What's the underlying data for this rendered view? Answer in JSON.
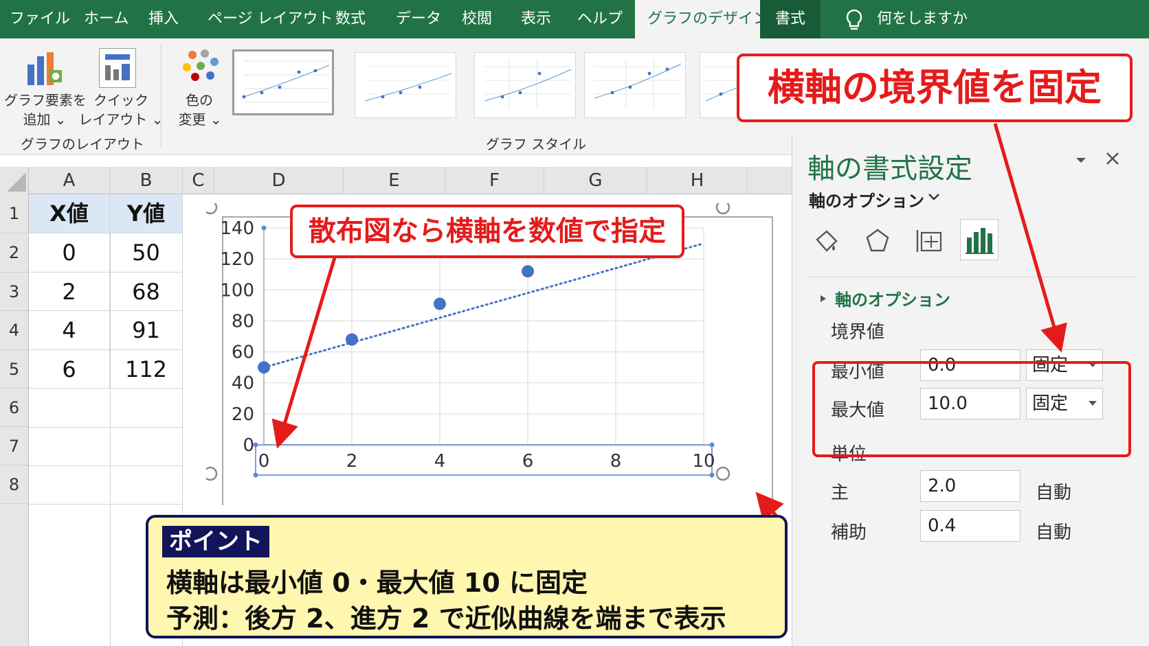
{
  "tabs": [
    "ファイル",
    "ホーム",
    "挿入",
    "ページ レイアウト",
    "数式",
    "データ",
    "校閲",
    "表示",
    "ヘルプ",
    "グラフのデザイン",
    "書式"
  ],
  "tell_me": "何をしますか",
  "ribbon": {
    "add_element_line1": "グラフ要素を",
    "add_element_line2": "追加 ⌄",
    "quick_layout_line1": "クイック",
    "quick_layout_line2": "レイアウト ⌄",
    "change_color_line1": "色の",
    "change_color_line2": "変更 ⌄",
    "group_layout": "グラフのレイアウト",
    "group_style": "グラフ スタイル"
  },
  "sheet": {
    "columns": [
      "A",
      "B",
      "C",
      "D",
      "E",
      "F",
      "G",
      "H"
    ],
    "rows": [
      "1",
      "2",
      "3",
      "4",
      "5",
      "6",
      "7",
      "8"
    ],
    "header_x": "X値",
    "header_y": "Y値",
    "x_values": [
      "0",
      "2",
      "4",
      "6"
    ],
    "y_values": [
      "50",
      "68",
      "91",
      "112"
    ]
  },
  "chart_data": {
    "type": "scatter",
    "x": [
      0,
      2,
      4,
      6
    ],
    "y": [
      50,
      68,
      91,
      112
    ],
    "xlim": [
      0,
      10
    ],
    "ylim": [
      0,
      140
    ],
    "x_ticks": [
      "0",
      "2",
      "4",
      "6",
      "8",
      "10"
    ],
    "y_ticks": [
      "0",
      "20",
      "40",
      "60",
      "80",
      "100",
      "120",
      "140"
    ],
    "trendline": {
      "style": "dotted",
      "from": [
        0,
        50
      ],
      "to": [
        10,
        130
      ]
    },
    "grid": true,
    "point_color": "#4472c4"
  },
  "pane": {
    "title": "軸の書式設定",
    "options_dropdown": "軸のオプション",
    "section": "軸のオプション",
    "bounds_label": "境界値",
    "min_label": "最小値",
    "min_value": "0.0",
    "min_mode": "固定",
    "max_label": "最大値",
    "max_value": "10.0",
    "max_mode": "固定",
    "units_label": "単位",
    "major_label": "主",
    "major_value": "2.0",
    "major_mode": "自動",
    "minor_label": "補助",
    "minor_value": "0.4",
    "minor_mode": "自動"
  },
  "annotations": {
    "top_callout": "横軸の境界値を固定",
    "chart_callout": "散布図なら横軸を数値で指定",
    "point_badge": "ポイント",
    "point_line1": "横軸は最小値 0・最大値 10 に固定",
    "point_line2": "予測：後方 2、進方 2 で近似曲線を端まで表示"
  },
  "colors": {
    "excel_green": "#217346",
    "callout_red": "#e51b1b",
    "note_bg": "#fff6b0",
    "note_border": "#14145a"
  }
}
